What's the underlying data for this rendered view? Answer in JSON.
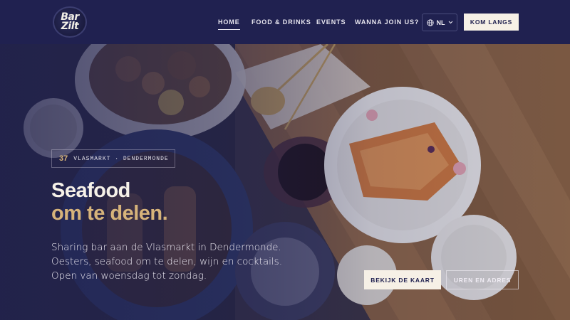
{
  "brand": {
    "logo_line1": "Bar",
    "logo_line2": "Zilt"
  },
  "nav": {
    "items": [
      {
        "label": "HOME",
        "active": true
      },
      {
        "label": "FOOD & DRINKS",
        "active": false
      },
      {
        "label": "EVENTS",
        "active": false
      },
      {
        "label": "WANNA JOIN US?",
        "active": false
      }
    ],
    "language": "NL",
    "language_icon": "globe-icon",
    "cta": "KOM LANGS"
  },
  "hero": {
    "badge_number": "37",
    "badge_text": "VLASMARKT · DENDERMONDE",
    "headline_line1": "Seafood",
    "headline_line2": "om te delen.",
    "subtitle": "Sharing bar aan de Vlasmarkt in Dendermonde. Oesters, seafood om te delen, wijn en cocktails. Open van woensdag tot zondag.",
    "primary_button": "BEKIJK DE KAART",
    "secondary_button": "UREN EN ADRES"
  },
  "colors": {
    "header_bg": "#202150",
    "accent_gold": "#d6b37a",
    "cream": "#f6f0e6"
  }
}
